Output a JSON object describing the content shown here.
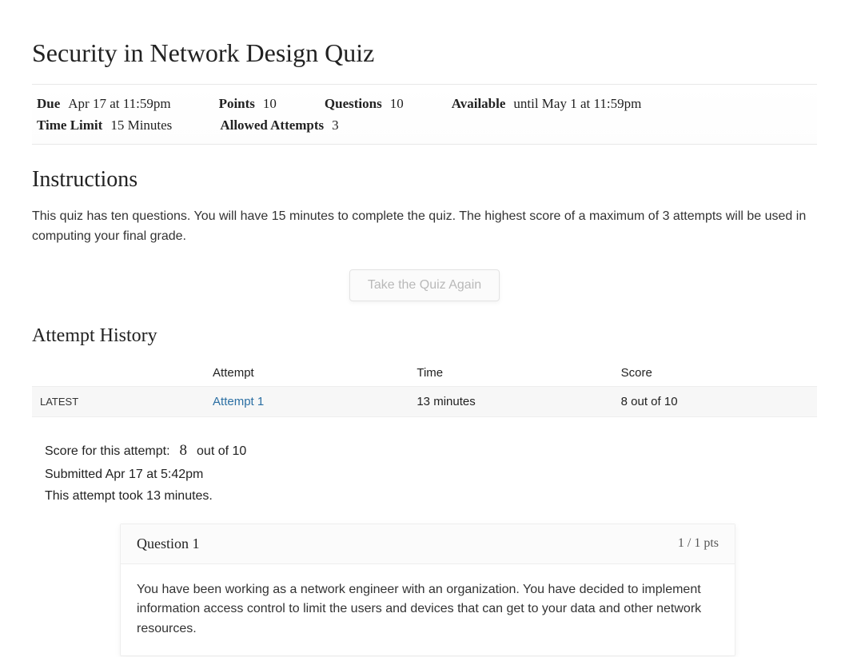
{
  "title": "Security in Network Design Quiz",
  "meta": {
    "due_label": "Due",
    "due_value": "Apr 17 at 11:59pm",
    "points_label": "Points",
    "points_value": "10",
    "questions_label": "Questions",
    "questions_value": "10",
    "available_label": "Available",
    "available_value": "until May 1 at 11:59pm",
    "time_limit_label": "Time Limit",
    "time_limit_value": "15 Minutes",
    "attempts_label": "Allowed Attempts",
    "attempts_value": "3"
  },
  "instructions_heading": "Instructions",
  "instructions_text": "This quiz has ten questions. You will have 15 minutes to complete the quiz. The highest score of a maximum of 3 attempts will be used in computing your final grade.",
  "take_again_label": "Take the Quiz Again",
  "attempt_history_heading": "Attempt History",
  "attempt_table": {
    "headers": {
      "attempt": "Attempt",
      "time": "Time",
      "score": "Score"
    },
    "rows": [
      {
        "latest": "LATEST",
        "attempt": "Attempt 1",
        "time": "13 minutes",
        "score": "8 out of 10"
      }
    ]
  },
  "score_block": {
    "label": "Score for this attempt:",
    "score": "8",
    "suffix": "out of 10",
    "submitted": "Submitted Apr 17 at 5:42pm",
    "duration": "This attempt took 13 minutes."
  },
  "question": {
    "title": "Question 1",
    "points": "1 / 1 pts",
    "body": "You have been working as a network engineer with an organization. You have decided to implement information access control to limit the users and devices that can get to your data and other network resources."
  }
}
